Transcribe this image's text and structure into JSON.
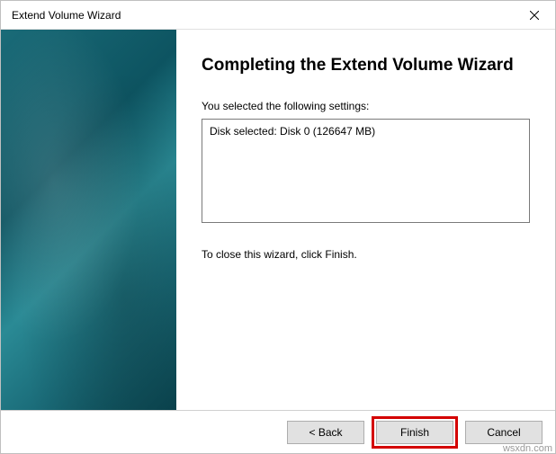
{
  "titlebar": {
    "title": "Extend Volume Wizard"
  },
  "main": {
    "heading": "Completing the Extend Volume Wizard",
    "settings_label": "You selected the following settings:",
    "settings_value": "Disk selected: Disk 0 (126647 MB)",
    "instruction": "To close this wizard, click Finish."
  },
  "buttons": {
    "back": "< Back",
    "finish": "Finish",
    "cancel": "Cancel"
  },
  "watermark": "wsxdn.com"
}
